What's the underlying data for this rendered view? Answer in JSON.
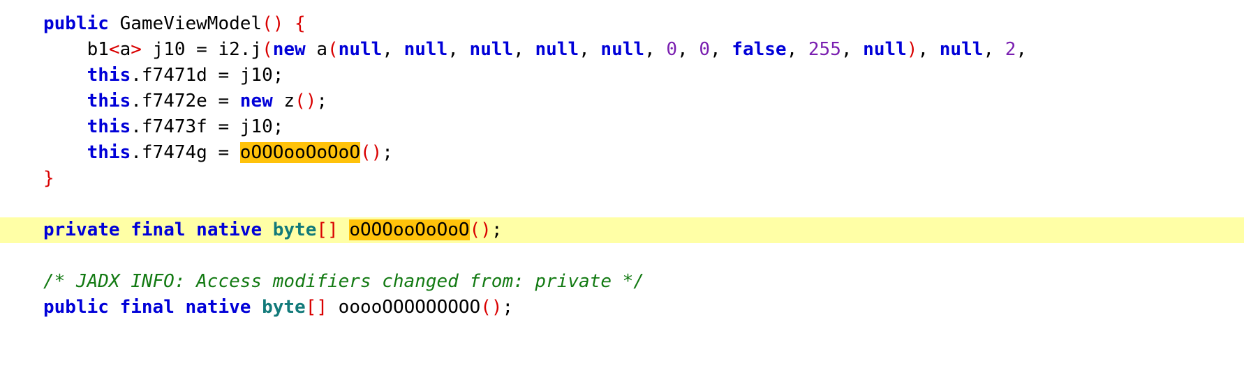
{
  "editor": {
    "lines": [
      [
        {
          "t": "public",
          "c": "kw"
        },
        {
          "t": " GameViewModel",
          "c": ""
        },
        {
          "t": "()",
          "c": "br"
        },
        {
          "t": " ",
          "c": ""
        },
        {
          "t": "{",
          "c": "br"
        }
      ],
      [
        {
          "t": "    b1",
          "c": ""
        },
        {
          "t": "<",
          "c": "br"
        },
        {
          "t": "a",
          "c": ""
        },
        {
          "t": ">",
          "c": "br"
        },
        {
          "t": " j10 = i2.j",
          "c": ""
        },
        {
          "t": "(",
          "c": "br"
        },
        {
          "t": "new",
          "c": "kw"
        },
        {
          "t": " a",
          "c": ""
        },
        {
          "t": "(",
          "c": "br"
        },
        {
          "t": "null",
          "c": "kw"
        },
        {
          "t": ", ",
          "c": ""
        },
        {
          "t": "null",
          "c": "kw"
        },
        {
          "t": ", ",
          "c": ""
        },
        {
          "t": "null",
          "c": "kw"
        },
        {
          "t": ", ",
          "c": ""
        },
        {
          "t": "null",
          "c": "kw"
        },
        {
          "t": ", ",
          "c": ""
        },
        {
          "t": "null",
          "c": "kw"
        },
        {
          "t": ", ",
          "c": ""
        },
        {
          "t": "0",
          "c": "num"
        },
        {
          "t": ", ",
          "c": ""
        },
        {
          "t": "0",
          "c": "num"
        },
        {
          "t": ", ",
          "c": ""
        },
        {
          "t": "false",
          "c": "kw"
        },
        {
          "t": ", ",
          "c": ""
        },
        {
          "t": "255",
          "c": "num"
        },
        {
          "t": ", ",
          "c": ""
        },
        {
          "t": "null",
          "c": "kw"
        },
        {
          "t": ")",
          "c": "br"
        },
        {
          "t": ", ",
          "c": ""
        },
        {
          "t": "null",
          "c": "kw"
        },
        {
          "t": ", ",
          "c": ""
        },
        {
          "t": "2",
          "c": "num"
        },
        {
          "t": ",",
          "c": ""
        }
      ],
      [
        {
          "t": "    ",
          "c": ""
        },
        {
          "t": "this",
          "c": "kw"
        },
        {
          "t": ".f7471d = j10;",
          "c": ""
        }
      ],
      [
        {
          "t": "    ",
          "c": ""
        },
        {
          "t": "this",
          "c": "kw"
        },
        {
          "t": ".f7472e = ",
          "c": ""
        },
        {
          "t": "new",
          "c": "kw"
        },
        {
          "t": " z",
          "c": ""
        },
        {
          "t": "()",
          "c": "br"
        },
        {
          "t": ";",
          "c": ""
        }
      ],
      [
        {
          "t": "    ",
          "c": ""
        },
        {
          "t": "this",
          "c": "kw"
        },
        {
          "t": ".f7473f = j10;",
          "c": ""
        }
      ],
      [
        {
          "t": "    ",
          "c": ""
        },
        {
          "t": "this",
          "c": "kw"
        },
        {
          "t": ".f7474g = ",
          "c": ""
        },
        {
          "t": "oOOOooOoOoO",
          "c": "hl"
        },
        {
          "t": "()",
          "c": "br"
        },
        {
          "t": ";",
          "c": ""
        }
      ],
      [
        {
          "t": "}",
          "c": "br"
        }
      ],
      [],
      [
        {
          "t": "private",
          "c": "kw"
        },
        {
          "t": " ",
          "c": ""
        },
        {
          "t": "final",
          "c": "kw"
        },
        {
          "t": " ",
          "c": ""
        },
        {
          "t": "native",
          "c": "kw"
        },
        {
          "t": " ",
          "c": ""
        },
        {
          "t": "byte",
          "c": "type"
        },
        {
          "t": "[]",
          "c": "br"
        },
        {
          "t": " ",
          "c": ""
        },
        {
          "t": "oOOOooOoOoO",
          "c": "hl"
        },
        {
          "t": "()",
          "c": "br"
        },
        {
          "t": ";",
          "c": ""
        }
      ],
      [],
      [
        {
          "t": "/* JADX INFO: Access modifiers changed from: private */",
          "c": "cmt"
        }
      ],
      [
        {
          "t": "public",
          "c": "kw"
        },
        {
          "t": " ",
          "c": ""
        },
        {
          "t": "final",
          "c": "kw"
        },
        {
          "t": " ",
          "c": ""
        },
        {
          "t": "native",
          "c": "kw"
        },
        {
          "t": " ",
          "c": ""
        },
        {
          "t": "byte",
          "c": "type"
        },
        {
          "t": "[]",
          "c": "br"
        },
        {
          "t": " ooooOOOOOOOOO",
          "c": ""
        },
        {
          "t": "()",
          "c": "br"
        },
        {
          "t": ";",
          "c": ""
        }
      ]
    ],
    "current_line": 8
  }
}
